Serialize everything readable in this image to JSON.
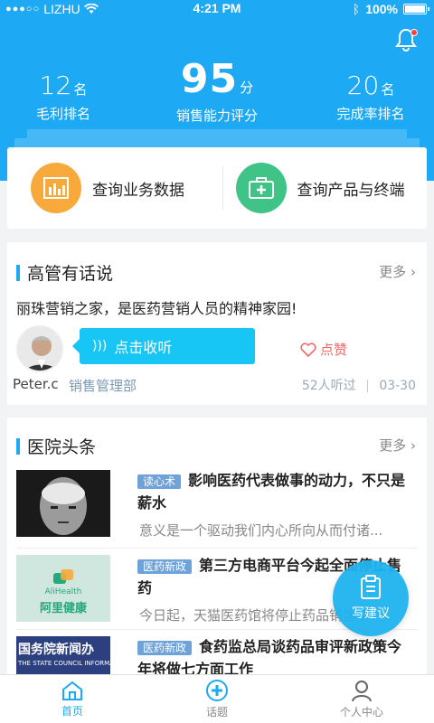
{
  "status_bar": {
    "carrier": "LIZHU",
    "time": "4:21 PM",
    "battery": "100%"
  },
  "stats": {
    "margin_rank": {
      "value": "12",
      "unit": "名",
      "label": "毛利排名"
    },
    "sales_score": {
      "value": "95",
      "unit": "分",
      "label": "销售能力评分"
    },
    "completion_rank": {
      "value": "20",
      "unit": "名",
      "label": "完成率排名"
    }
  },
  "quick_actions": [
    {
      "label": "查询业务数据",
      "icon": "bar-chart-icon",
      "color": "#f7a93b"
    },
    {
      "label": "查询产品与终端",
      "icon": "medical-kit-icon",
      "color": "#3fc387"
    }
  ],
  "executive_talk": {
    "title": "高管有话说",
    "more": "更多",
    "slogan": "丽珠营销之家，是医药营销人员的精神家园!",
    "listen_label": "点击收听",
    "like_label": "点赞",
    "author": "Peter.c",
    "department": "销售管理部",
    "listen_count": "52人听过",
    "date": "03-30"
  },
  "hospital_news": {
    "title": "医院头条",
    "more": "更多",
    "items": [
      {
        "tag": "读心术",
        "title": "影响医药代表做事的动力，不只是薪水",
        "desc": "意义是一个驱动我们内心所向从而付诸..."
      },
      {
        "tag": "医药新政",
        "title": "第三方电商平台今起全面停止售药",
        "desc": "今日起，天猫医药馆将停止药品销售..."
      },
      {
        "tag": "医药新政",
        "title": "食药监总局谈药品审评新政策今年将做七方面工作",
        "desc": ""
      }
    ],
    "thumb_texts": {
      "alihealth_en": "AliHealth",
      "alihealth_cn": "阿里健康",
      "council_cn": "国务院新闻办",
      "council_en": "THE STATE COUNCIL INFORMATION"
    }
  },
  "fab_label": "写建议",
  "tabs": [
    {
      "label": "首页",
      "icon": "home-icon"
    },
    {
      "label": "话题",
      "icon": "plus-circle-icon"
    },
    {
      "label": "个人中心",
      "icon": "user-icon"
    }
  ],
  "colors": {
    "primary": "#1da9f3",
    "accent_orange": "#f7a93b",
    "accent_green": "#3fc387",
    "like_red": "#f06a6a"
  }
}
